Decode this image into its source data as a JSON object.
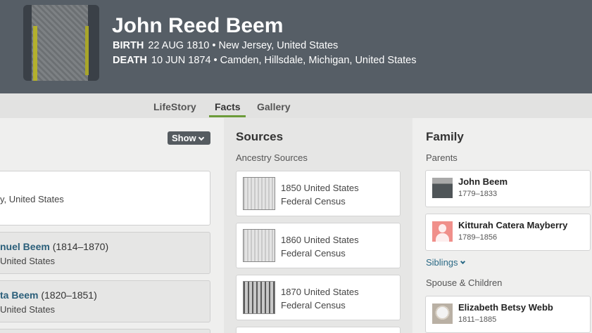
{
  "header": {
    "name": "John Reed Beem",
    "birth_label": "BIRTH",
    "birth_value": "22 AUG 1810 • New Jersey, United States",
    "death_label": "DEATH",
    "death_value": "10 JUN 1874 • Camden, Hillsdale, Michigan, United States"
  },
  "tabs": [
    {
      "label": "LifeStory"
    },
    {
      "label": "Facts",
      "active": true
    },
    {
      "label": "Gallery"
    }
  ],
  "facts": {
    "show_label": "Show",
    "birth_place_partial": "y, United States",
    "events": [
      {
        "name": "nuel Beem",
        "years": "(1814–1870)",
        "place": "United States"
      },
      {
        "name": "ta Beem",
        "years": "(1820–1851)",
        "place": "United States"
      }
    ]
  },
  "sources": {
    "title": "Sources",
    "subtitle": "Ancestry Sources",
    "items": [
      {
        "line1": "1850 United States",
        "line2": "Federal Census"
      },
      {
        "line1": "1860 United States",
        "line2": "Federal Census"
      },
      {
        "line1": "1870 United States",
        "line2": "Federal Census"
      }
    ]
  },
  "family": {
    "title": "Family",
    "parents_label": "Parents",
    "parents": [
      {
        "name": "John Beem",
        "dates": "1779–1833"
      },
      {
        "name": "Kitturah Catera Mayberry",
        "dates": "1789–1856"
      }
    ],
    "siblings_label": "Siblings",
    "spouse_label": "Spouse & Children",
    "spouses": [
      {
        "name": "Elizabeth Betsy Webb",
        "dates": "1811–1885"
      }
    ]
  },
  "colors": {
    "header_bg": "#565e66",
    "tab_active_underline": "#6c9b3a",
    "link": "#2b5f7a",
    "show_button_bg": "#555b60"
  },
  "icons": [
    "chevron-down-icon",
    "headstone-photo",
    "person-silhouette-icon"
  ]
}
